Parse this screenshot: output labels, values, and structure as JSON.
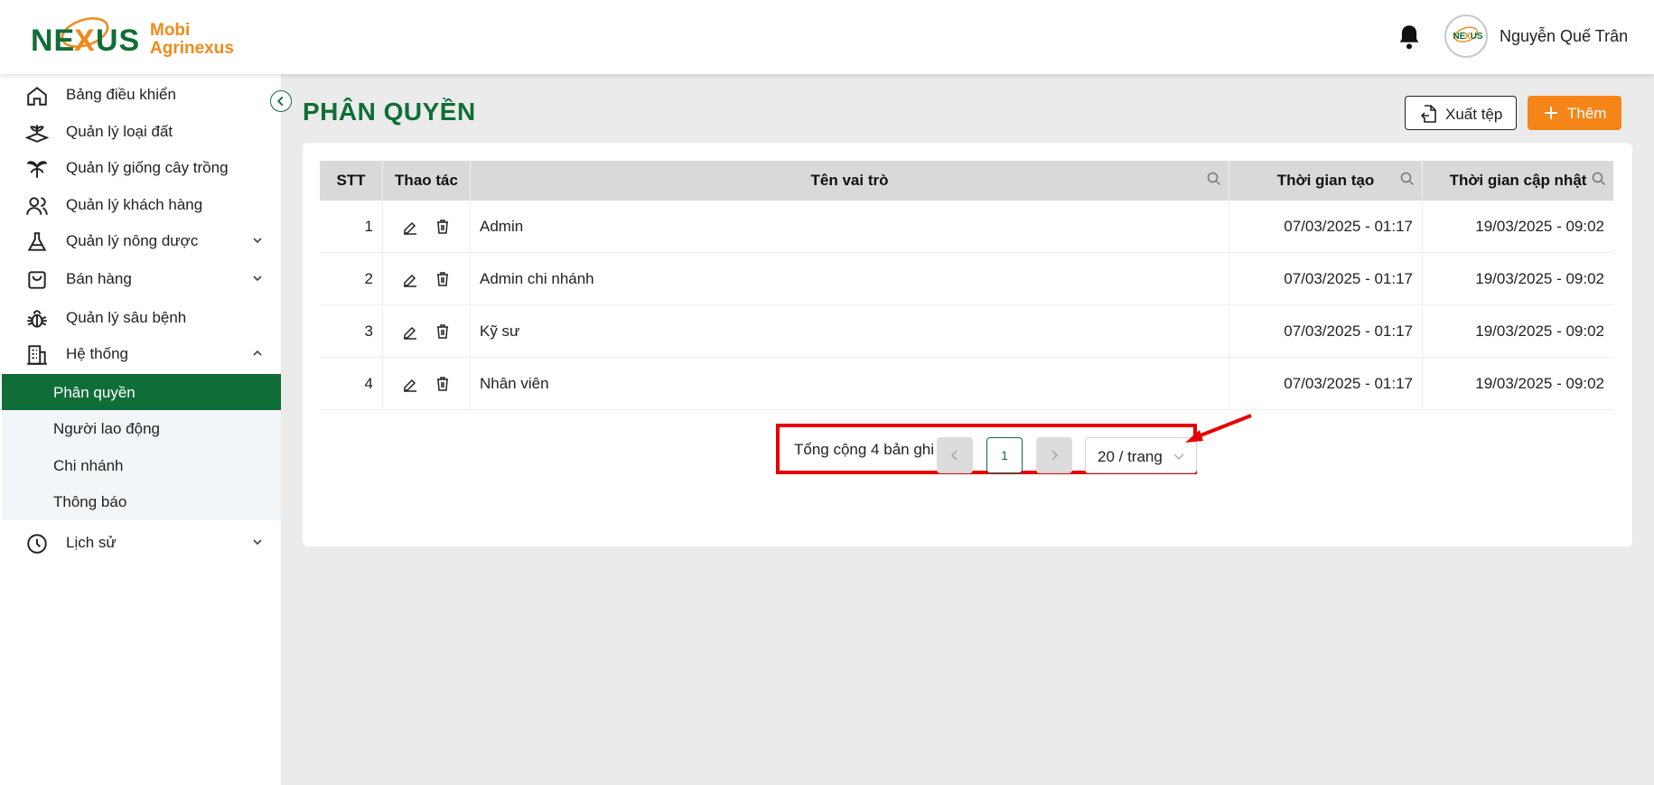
{
  "header": {
    "brand_line1": "Mobi",
    "brand_line2": "Agrinexus",
    "logo_word": "NEXUS",
    "user_name": "Nguyễn Quế Trân"
  },
  "sidebar": {
    "items": [
      {
        "label": "Bảng điều khiển",
        "icon": "home-icon"
      },
      {
        "label": "Quản lý loại đất",
        "icon": "soil-icon"
      },
      {
        "label": "Quản lý giống cây trồng",
        "icon": "plant-icon"
      },
      {
        "label": "Quản lý khách hàng",
        "icon": "users-icon"
      },
      {
        "label": "Quản lý nông dược",
        "icon": "flask-icon"
      },
      {
        "label": "Bán hàng",
        "icon": "shopping-bag-icon"
      },
      {
        "label": "Quản lý sâu bệnh",
        "icon": "bug-icon"
      },
      {
        "label": "Hệ thống",
        "icon": "building-icon"
      },
      {
        "label": "Lịch sử",
        "icon": "clock-icon"
      }
    ],
    "sub_items": [
      {
        "label": "Phân quyền",
        "active": true
      },
      {
        "label": "Người lao động"
      },
      {
        "label": "Chi nhánh"
      },
      {
        "label": "Thông báo"
      }
    ]
  },
  "main": {
    "title": "PHÂN QUYỀN",
    "export_label": "Xuất tệp",
    "add_label": "Thêm"
  },
  "table": {
    "columns": [
      "STT",
      "Thao tác",
      "Tên vai trò",
      "Thời gian tạo",
      "Thời gian cập nhật"
    ],
    "rows": [
      {
        "stt": "1",
        "name": "Admin",
        "created": "07/03/2025 - 01:17",
        "updated": "19/03/2025 - 09:02"
      },
      {
        "stt": "2",
        "name": "Admin chi nhánh",
        "created": "07/03/2025 - 01:17",
        "updated": "19/03/2025 - 09:02"
      },
      {
        "stt": "3",
        "name": "Kỹ sư",
        "created": "07/03/2025 - 01:17",
        "updated": "19/03/2025 - 09:02"
      },
      {
        "stt": "4",
        "name": "Nhân viên",
        "created": "07/03/2025 - 01:17",
        "updated": "19/03/2025 - 09:02"
      }
    ]
  },
  "pagination": {
    "total_label": "Tổng cộng 4 bản ghi",
    "current_page": "1",
    "page_size_label": "20 / trang"
  },
  "colors": {
    "brand_green": "#0f6e37",
    "brand_orange": "#f58518",
    "highlight_red": "#e60000"
  }
}
